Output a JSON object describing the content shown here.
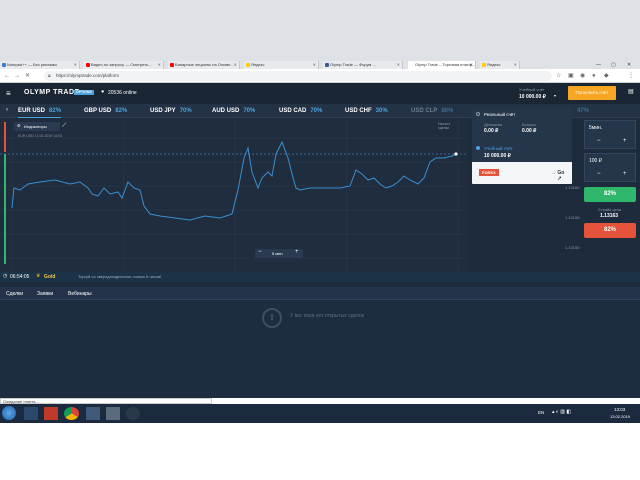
{
  "browser": {
    "tabs": [
      {
        "title": "Notepad++ — Без рекламы",
        "color": "#3a7bd5"
      },
      {
        "title": "Видео по запросу — Смотреть...",
        "color": "#ff0000"
      },
      {
        "title": "Бинарные опционы на Олимп...",
        "color": "#ff0000"
      },
      {
        "title": "Яндекс",
        "color": "#ffcc00"
      },
      {
        "title": "Olymp Trade — Форум ...",
        "color": "#3b5998"
      },
      {
        "title": "Olymp Trade – Торговая платф...",
        "color": "#ffffff"
      },
      {
        "title": "Яндекс",
        "color": "#ffcc00"
      }
    ],
    "url": "https://olymptrade.com/platform",
    "status": "Ожидание ответа...",
    "window_controls": [
      "—",
      "▢",
      "✕"
    ]
  },
  "app": {
    "brand": "OLYMP TRADE",
    "brand_badge": "OPTIONS",
    "online_count": "20536 online",
    "account_type": "Учебный счёт",
    "balance": "10 000.00 ₽",
    "deposit_button": "Пополнить счёт",
    "help_icon": "book-icon",
    "assets": [
      {
        "name": "EUR USD",
        "pct": "82%",
        "active": true
      },
      {
        "name": "GBP USD",
        "pct": "82%"
      },
      {
        "name": "USD JPY",
        "pct": "70%"
      },
      {
        "name": "AUD USD",
        "pct": "70%"
      },
      {
        "name": "USD CAD",
        "pct": "70%"
      },
      {
        "name": "USD CHF",
        "pct": "30%"
      },
      {
        "name": "USD CLP",
        "pct": "80%",
        "dim": true
      },
      {
        "name": "",
        "pct": "47%",
        "dim": true
      }
    ],
    "indicators_label": "Индикаторы",
    "chart_info": "EUR USD 13.02.2019 14:03",
    "trade_start_label": "Начало\nсделки",
    "timeframe": "5 мин",
    "minus": "−",
    "plus": "+",
    "x_ticks": [
      "13:02",
      "13:03",
      "13:04",
      "13:05",
      "13:06"
    ],
    "y_ticks": [
      "1.13160",
      "1.13155",
      "1.13150"
    ],
    "gold": {
      "time": "06:54:05",
      "label": "Gold",
      "text": "Торгуй со сверхдоходностью только 6 часов!"
    },
    "trade_tabs": [
      "Сделки",
      "Заявки",
      "Вебинары"
    ],
    "empty_text": "У вас пока нет открытых сделок",
    "account_menu": {
      "real_title": "Реальный счёт",
      "deposit_label": "Депозиты",
      "deposit_value": "0.00 ₽",
      "bonus_label": "Бонусы",
      "bonus_value": "0.00 ₽",
      "demo_title": "Учебный счёт",
      "demo_value": "10 000.00 ₽",
      "forex_badge": "FOREX",
      "go_label": "→ Go"
    },
    "right_panel": {
      "duration": "5мин.",
      "amount": "100 ₽",
      "up_pct": "82%",
      "strike_label": "Страйк цена",
      "strike_value": "1.13163",
      "down_pct": "82%"
    }
  },
  "taskbar": {
    "lang": "EN",
    "time": "13:03",
    "date": "13.02.2019"
  },
  "colors": {
    "up": "#2fb86b",
    "down": "#e5533a",
    "accent": "#4aa3df",
    "deposit": "#f5a623"
  }
}
